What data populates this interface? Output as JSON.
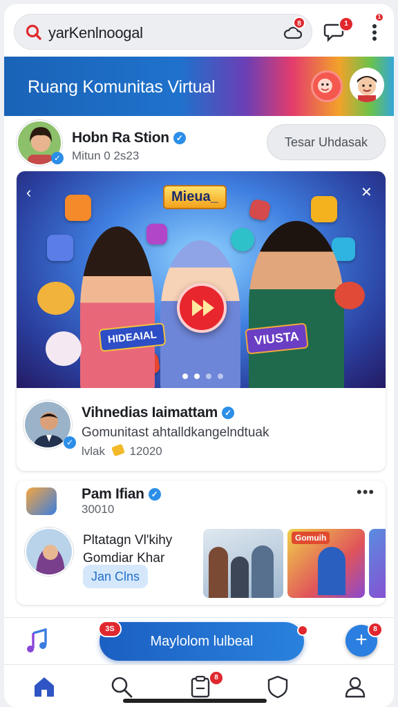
{
  "search": {
    "query": "yarKenlnoogal",
    "cloud_badge": "8",
    "chat_badge": "1",
    "more_badge": "1"
  },
  "banner": {
    "title": "Ruang Komunitas Virtual"
  },
  "post": {
    "author_name": "Hobn Ra Stion",
    "author_meta": "Mitun 0 2s23",
    "follow_label": "Tesar Uhdasak",
    "media_tag": "Mieua_",
    "sign_left": "HIDEAIAL",
    "sign_right": "VIUSTA",
    "caption_author": "Vihnedias Iaimattam",
    "caption_text": "Gomunitast ahtalldkangelndtuak",
    "caption_meta": "lvlak",
    "caption_count": "12020"
  },
  "card2": {
    "name": "Pam Ifian",
    "meta": "30010",
    "user_line1": "Pltatagn Vl'kihy",
    "user_line2": "Gomdiar Khar",
    "pill": "Jan Clns",
    "thumb_caption_1": "Gomuih"
  },
  "actionbar": {
    "left_badge": "3S",
    "cta_label": "Maylolom lulbeal",
    "fab_symbol": "+",
    "fab_badge": "8"
  },
  "tabbar": {
    "tasks_badge": "8"
  },
  "colors": {
    "accent": "#2a7fe0",
    "badge": "#e0282e",
    "verified": "#2b8ee8"
  },
  "icons": [
    "search-logo-icon",
    "cloud-icon",
    "chat-icon",
    "more-vertical-icon",
    "verified-icon",
    "chevron-left-icon",
    "close-icon",
    "play-icon",
    "ellipsis-icon",
    "music-note-icon",
    "plus-icon",
    "home-icon",
    "search-icon",
    "clipboard-icon",
    "shield-icon",
    "profile-icon"
  ]
}
